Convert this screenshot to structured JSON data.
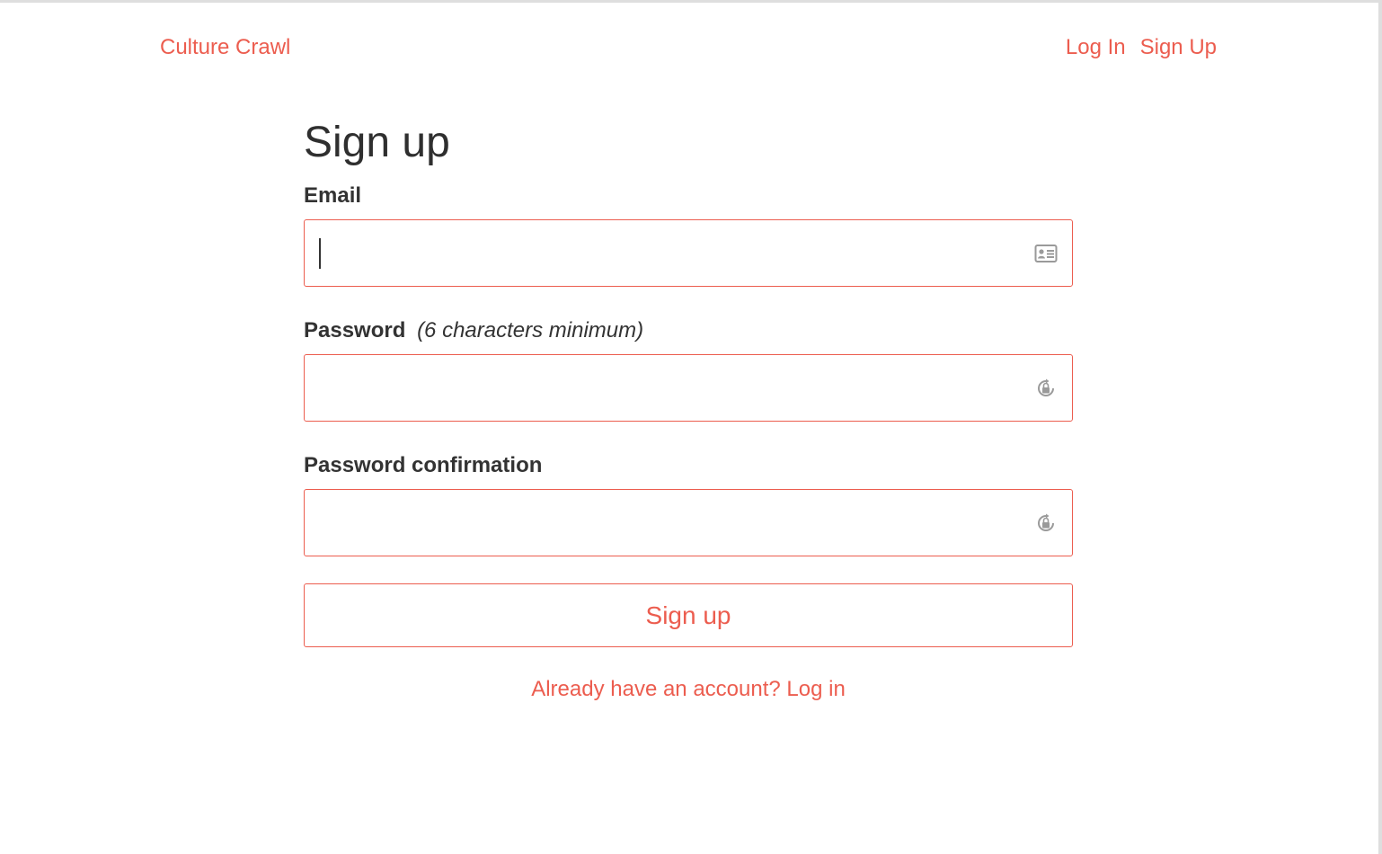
{
  "navbar": {
    "brand": "Culture Crawl",
    "links": [
      {
        "label": "Log In"
      },
      {
        "label": "Sign Up"
      }
    ]
  },
  "form": {
    "title": "Sign up",
    "email": {
      "label": "Email",
      "value": "",
      "icon": "contact-card-icon"
    },
    "password": {
      "label": "Password",
      "hint": "(6 characters minimum)",
      "value": "",
      "icon": "password-lock-icon"
    },
    "password_confirmation": {
      "label": "Password confirmation",
      "value": "",
      "icon": "password-lock-icon"
    },
    "submit_label": "Sign up",
    "login_link": "Already have an account? Log in"
  },
  "colors": {
    "accent": "#ec5d4f",
    "text": "#333333",
    "icon": "#9a9a9a"
  }
}
